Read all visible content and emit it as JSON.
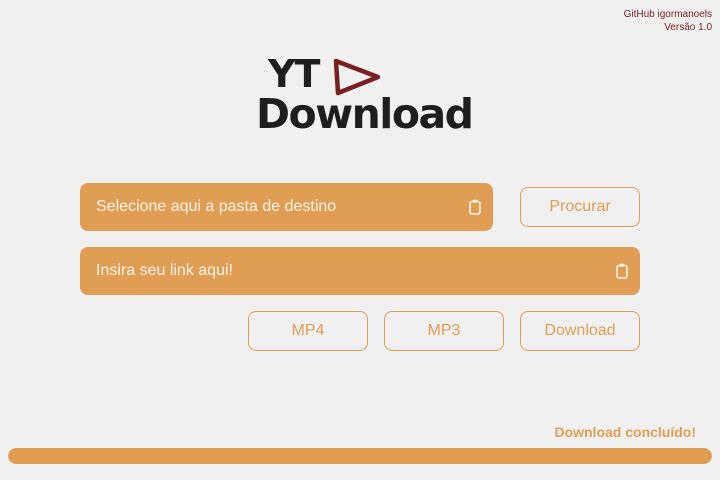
{
  "credits": {
    "github": "GitHub igormanoels",
    "version": "Versão 1.0"
  },
  "logo": {
    "line1": "YT",
    "line2": "Download",
    "play_icon": "play-triangle-outline"
  },
  "folder_field": {
    "placeholder": "Selecione aqui a pasta de destino",
    "icon": "clipboard-icon"
  },
  "browse_button": {
    "label": "Procurar"
  },
  "link_field": {
    "placeholder": "Insira seu link aqui!",
    "icon": "clipboard-icon"
  },
  "format_buttons": {
    "mp4": "MP4",
    "mp3": "MP3",
    "download": "Download"
  },
  "status": {
    "message": "Download concluído!",
    "progress_percent": 100
  },
  "colors": {
    "accent": "#e09d54",
    "credit_text": "#7a2222",
    "logo_text": "#1e1e1e",
    "play_icon": "#7a1f1f",
    "background": "#f0f0f0"
  }
}
